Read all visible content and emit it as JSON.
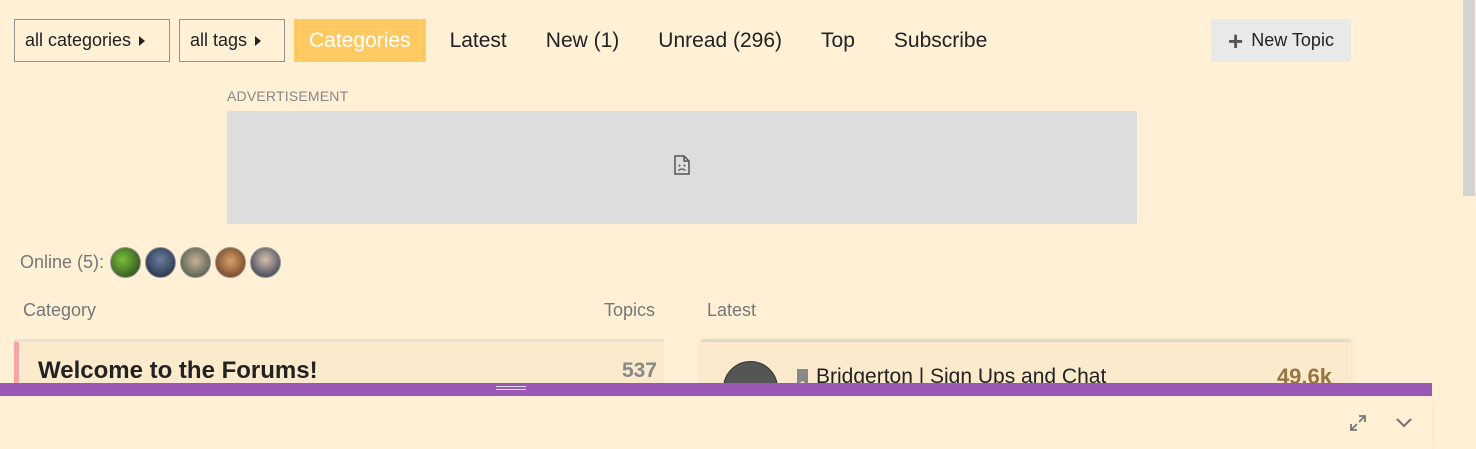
{
  "nav": {
    "categories_dropdown": "all categories",
    "tags_dropdown": "all tags",
    "tabs": [
      {
        "label": "Categories",
        "active": true
      },
      {
        "label": "Latest",
        "active": false
      },
      {
        "label": "New (1)",
        "active": false
      },
      {
        "label": "Unread (296)",
        "active": false
      },
      {
        "label": "Top",
        "active": false
      },
      {
        "label": "Subscribe",
        "active": false
      }
    ],
    "new_topic": "New Topic"
  },
  "ad": {
    "label": "ADVERTISEMENT",
    "icon": "broken-image-icon"
  },
  "online": {
    "label": "Online (5):",
    "avatars": [
      "user-avatar-1",
      "user-avatar-2",
      "user-avatar-3",
      "user-avatar-4",
      "user-avatar-5"
    ]
  },
  "category_table": {
    "header_category": "Category",
    "header_topics": "Topics",
    "rows": [
      {
        "name": "Welcome to the Forums!",
        "topics": "537"
      }
    ]
  },
  "latest_table": {
    "header": "Latest",
    "rows": [
      {
        "title": "Bridgerton | Sign Ups and Chat",
        "count": "49.6k",
        "icon": "bookmark-icon"
      }
    ]
  },
  "colors": {
    "background": "#fff0d6",
    "active_tab": "#ffca61",
    "panel_bar": "#9b59b6",
    "category_stripe": "#f4a5a5",
    "count_accent": "#98753d"
  },
  "panel_icons": [
    "expand-icon",
    "chevron-down-icon"
  ]
}
